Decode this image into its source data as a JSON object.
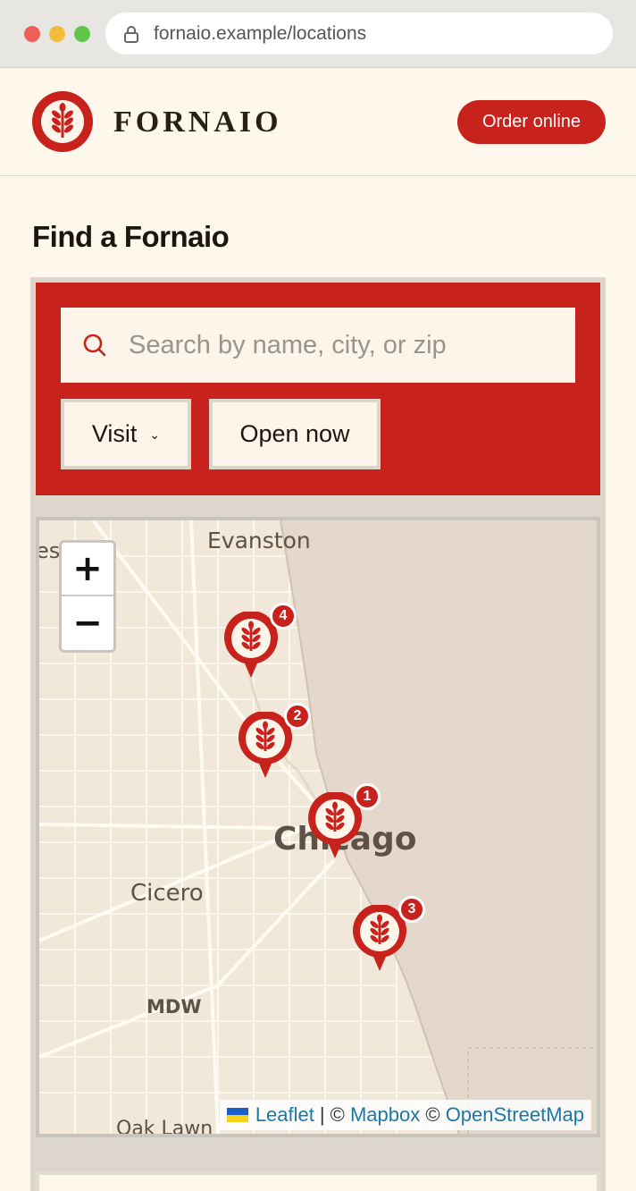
{
  "browser": {
    "url": "fornaio.example/locations"
  },
  "header": {
    "brand": "FORNAIO",
    "order_label": "Order online"
  },
  "page": {
    "title": "Find a Fornaio"
  },
  "search": {
    "placeholder": "Search by name, city, or zip",
    "value": ""
  },
  "filters": {
    "visit_label": "Visit",
    "open_now_label": "Open now"
  },
  "map": {
    "labels": {
      "evanston": "Evanston",
      "partial_left": "es",
      "chicago": "Chicago",
      "cicero": "Cicero",
      "mdw": "MDW",
      "oak_lawn": "Oak Lawn"
    },
    "zoom_in": "+",
    "zoom_out": "−",
    "pins": [
      {
        "number": "4"
      },
      {
        "number": "2"
      },
      {
        "number": "1"
      },
      {
        "number": "3"
      }
    ],
    "attribution": {
      "leaflet": "Leaflet",
      "mapbox": "Mapbox",
      "osm": "OpenStreetMap",
      "sep": "|",
      "copy": "©"
    }
  },
  "colors": {
    "brand_red": "#c8221d",
    "cream": "#fdf7ec",
    "lake": "#e4d8cd"
  }
}
